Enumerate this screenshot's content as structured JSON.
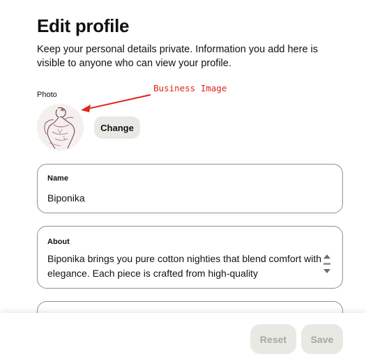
{
  "header": {
    "title": "Edit profile",
    "description": "Keep your personal details private. Information you add here is visible to anyone who can view your profile."
  },
  "photo": {
    "label": "Photo",
    "change_label": "Change",
    "avatar_icon": "profile-photo-sketch"
  },
  "annotation": {
    "text": "Business Image",
    "color": "#e0241a"
  },
  "fields": {
    "name": {
      "label": "Name",
      "value": "Biponika"
    },
    "about": {
      "label": "About",
      "value": "Biponika brings you pure cotton nighties that blend comfort with elegance. Each piece is crafted from high-quality"
    }
  },
  "footer": {
    "reset_label": "Reset",
    "save_label": "Save"
  }
}
